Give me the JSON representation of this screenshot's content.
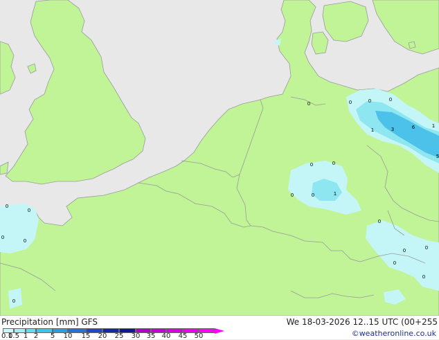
{
  "title": "Precipitation [mm]  GFS",
  "datetime": "We 18-03-2026 12..15 UTC (00+255",
  "credit": "©weatheronline.co.uk",
  "scale": {
    "ticks": [
      "0.1",
      "0.5",
      "1",
      "2",
      "5",
      "10",
      "15",
      "20",
      "25",
      "30",
      "35",
      "40",
      "45",
      "50"
    ],
    "colors": [
      "#c8f8f8",
      "#9ef0f4",
      "#64dcf0",
      "#3cc4ec",
      "#2c9ce0",
      "#2472d4",
      "#1c48c4",
      "#1428a4",
      "#101890",
      "#b400c4",
      "#c800d4",
      "#dc00dc",
      "#f000e8",
      "#ff00f8"
    ]
  },
  "colors": {
    "land": "#c0f496",
    "sea": "#e8e8e8",
    "border": "#9a9a9a",
    "precip_light": "#c4f6f8",
    "precip_mid": "#8ee6f0",
    "precip_heavy": "#4cc2ea"
  },
  "precip_labels": [
    "0",
    "0",
    "0",
    "0",
    "0",
    "0",
    "0",
    "1",
    "3",
    "6",
    "1",
    "5",
    "0",
    "0",
    "0",
    "1",
    "0",
    "0",
    "0",
    "0",
    "0",
    "0",
    "0",
    "0"
  ]
}
